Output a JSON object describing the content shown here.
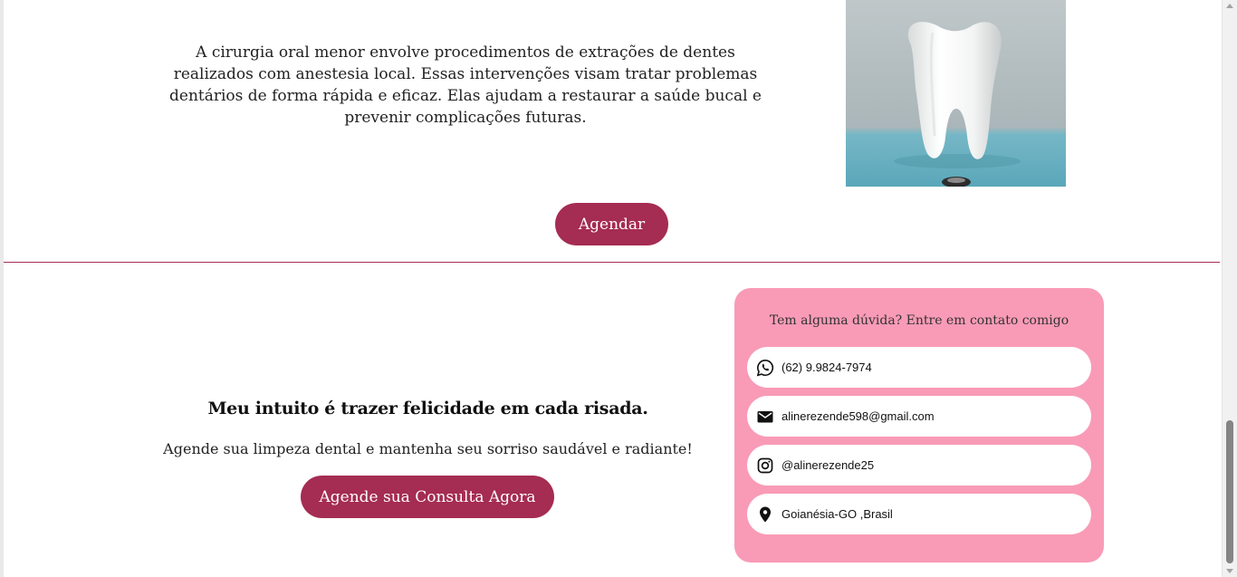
{
  "services": {
    "description": "A cirurgia oral menor envolve procedimentos de extrações de dentes realizados com anestesia local. Essas intervenções visam tratar problemas dentários de forma rápida e eficaz. Elas ajudam a restaurar a saúde bucal e prevenir complicações futuras.",
    "schedule_button_label": "Agendar"
  },
  "cta": {
    "tagline": "Meu intuito é trazer felicidade em cada risada.",
    "subtext": "Agende sua limpeza dental e mantenha seu sorriso saudável e radiante!",
    "button_label": "Agende sua Consulta Agora"
  },
  "contact": {
    "title": "Tem alguma dúvida? Entre em contato comigo",
    "items": [
      {
        "icon": "whatsapp-icon",
        "text": "(62) 9.9824-7974"
      },
      {
        "icon": "email-icon",
        "text": "alinerezende598@gmail.com"
      },
      {
        "icon": "instagram-icon",
        "text": "@alinerezende25"
      },
      {
        "icon": "location-pin-icon",
        "text": "Goianésia-GO ,Brasil"
      }
    ]
  },
  "colors": {
    "accent": "#a52c52",
    "card_background": "#f99bb6"
  }
}
